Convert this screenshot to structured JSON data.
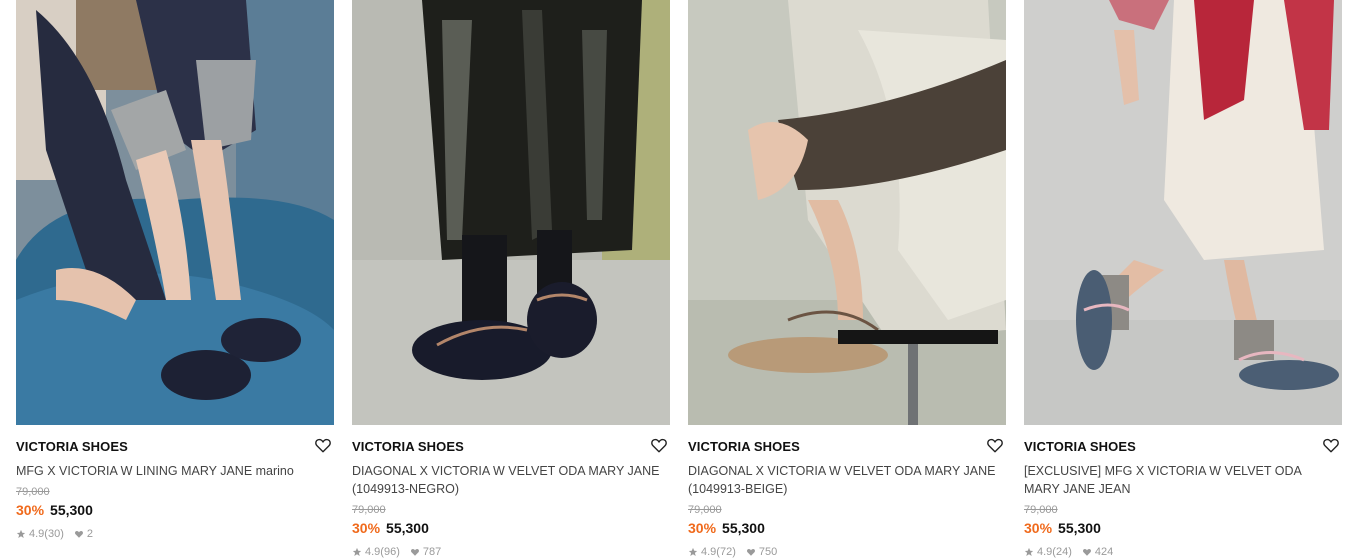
{
  "products": [
    {
      "brand": "VICTORIA SHOES",
      "name": "MFG X VICTORIA W LINING MARY JANE marino",
      "original_price": "79,000",
      "discount": "30%",
      "price": "55,300",
      "rating": "4.9(30)",
      "likes": "2"
    },
    {
      "brand": "VICTORIA SHOES",
      "name": "DIAGONAL X VICTORIA W VELVET ODA MARY JANE (1049913-NEGRO)",
      "original_price": "79,000",
      "discount": "30%",
      "price": "55,300",
      "rating": "4.9(96)",
      "likes": "787"
    },
    {
      "brand": "VICTORIA SHOES",
      "name": "DIAGONAL X VICTORIA W VELVET ODA MARY JANE (1049913-BEIGE)",
      "original_price": "79,000",
      "discount": "30%",
      "price": "55,300",
      "rating": "4.9(72)",
      "likes": "750"
    },
    {
      "brand": "VICTORIA SHOES",
      "name": "[EXCLUSIVE] MFG X VICTORIA W VELVET ODA MARY JANE JEAN",
      "original_price": "79,000",
      "discount": "30%",
      "price": "55,300",
      "rating": "4.9(24)",
      "likes": "424"
    }
  ],
  "icons": {
    "wishlist": "heart-outline-icon",
    "rating": "star-icon",
    "likes": "heart-icon"
  },
  "colors": {
    "discount": "#f06a1c",
    "muted": "#9a9a9a"
  }
}
